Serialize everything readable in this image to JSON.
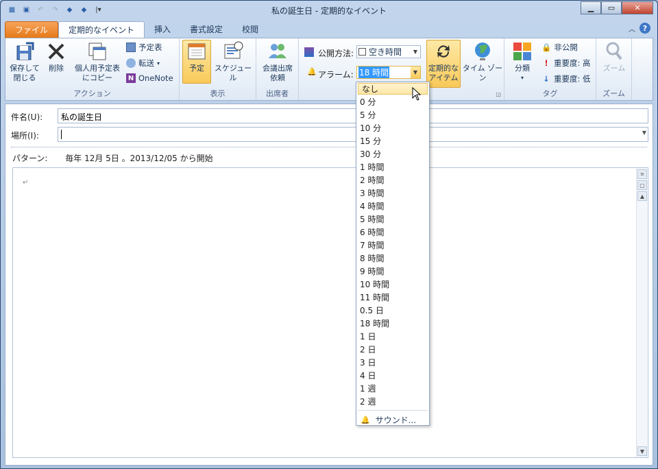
{
  "window": {
    "title": "私の誕生日 - 定期的なイベント",
    "controls": [
      "minimize",
      "maximize",
      "close"
    ]
  },
  "qat": [
    "calendar-icon",
    "save-icon",
    "undo-icon",
    "redo-icon",
    "up-arrow-icon",
    "down-arrow-icon",
    "customize-icon"
  ],
  "tabs": [
    "ファイル",
    "定期的なイベント",
    "挿入",
    "書式設定",
    "校閲"
  ],
  "ribbon": {
    "action": {
      "label": "アクション",
      "save_close": "保存して\n閉じる",
      "delete": "削除",
      "copy": "個人用予定表\nにコピー",
      "calendar": "予定表",
      "forward": "転送",
      "onenote": "OneNote"
    },
    "show": {
      "label": "表示",
      "appointment": "予定",
      "schedule": "スケジュール"
    },
    "attendees": {
      "label": "出席者",
      "invite": "会議出席\n依頼"
    },
    "options": {
      "show_as_label": "公開方法:",
      "show_as_value": "空き時間",
      "reminder_label": "アラーム:",
      "reminder_value": "18 時間",
      "recurrence": "定期的な\nアイテム",
      "timezone": "タイム ゾーン"
    },
    "tags": {
      "label": "タグ",
      "categorize": "分類",
      "private": "非公開",
      "high": "重要度: 高",
      "low": "重要度: 低"
    },
    "zoom": {
      "label": "ズーム",
      "zoom": "ズーム"
    }
  },
  "form": {
    "subject_label": "件名(U):",
    "subject_value": "私の誕生日",
    "location_label": "場所(I):",
    "location_value": "",
    "pattern_label": "パターン:",
    "pattern_value": "毎年 12月 5日 。2013/12/05 から開始",
    "pilcrow": "↵"
  },
  "dropdown": {
    "items": [
      "なし",
      "0 分",
      "5 分",
      "10 分",
      "15 分",
      "30 分",
      "1 時間",
      "2 時間",
      "3 時間",
      "4 時間",
      "5 時間",
      "6 時間",
      "7 時間",
      "8 時間",
      "9 時間",
      "10 時間",
      "11 時間",
      "0.5 日",
      "18 時間",
      "1 日",
      "2 日",
      "3 日",
      "4 日",
      "1 週",
      "2 週"
    ],
    "hovered": "なし",
    "sound": "サウンド..."
  },
  "colors": {
    "accent": "#e67a18",
    "highlight": "#fde7a6",
    "selection": "#3399ff"
  }
}
